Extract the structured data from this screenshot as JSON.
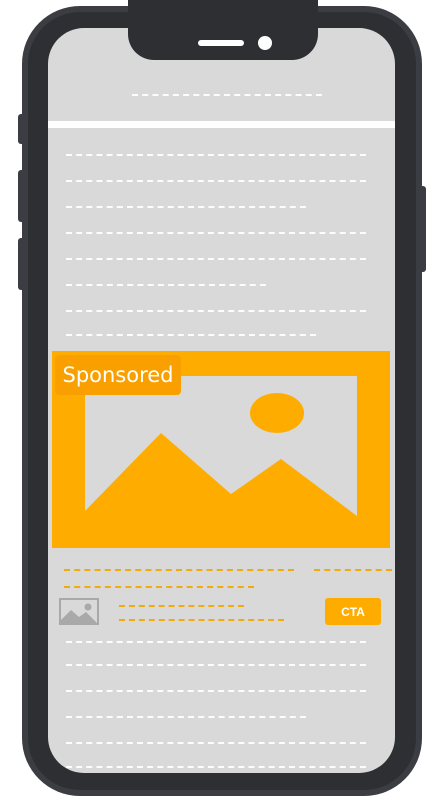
{
  "ad": {
    "label": "Sponsored",
    "cta_label": "CTA",
    "image_icon": "image-placeholder-icon",
    "thumbnail_icon": "image-thumbnail-icon"
  },
  "colors": {
    "accent": "#ffac00",
    "accent_dark": "#f9a000",
    "screen": "#d9d9d9",
    "phone_body": "#3b3d42",
    "placeholder_text": "#ffffff"
  },
  "icons": [
    "speaker-icon",
    "camera-icon",
    "image-placeholder-icon",
    "image-thumbnail-icon"
  ]
}
